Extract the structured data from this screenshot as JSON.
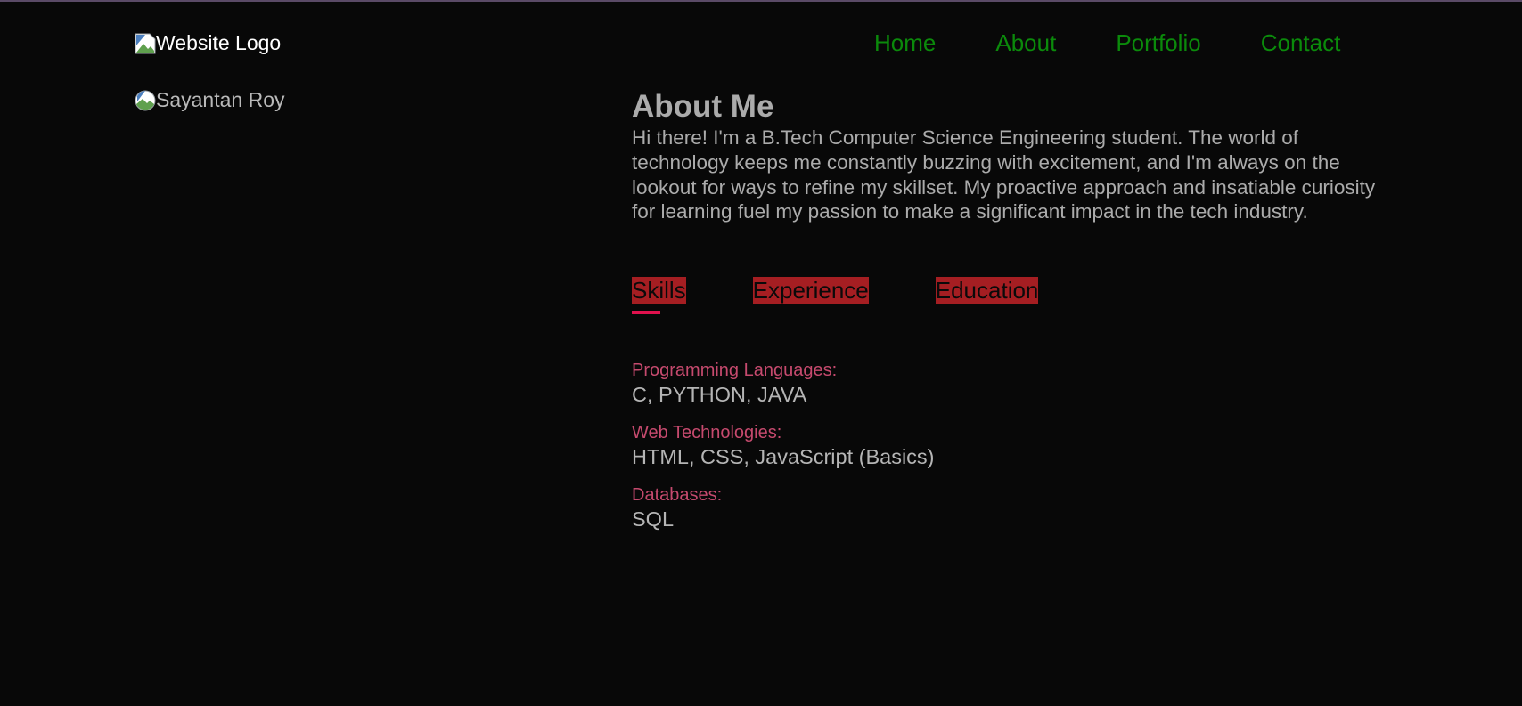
{
  "header": {
    "logo_alt": "Website Logo",
    "nav": [
      {
        "label": "Home"
      },
      {
        "label": "About"
      },
      {
        "label": "Portfolio"
      },
      {
        "label": "Contact"
      }
    ]
  },
  "profile": {
    "image_alt": "Sayantan Roy"
  },
  "about": {
    "title": "About Me",
    "text": "Hi there! I'm a B.Tech Computer Science Engineering student. The world of technology keeps me constantly buzzing with excitement, and I'm always on the lookout for ways to refine my skillset. My proactive approach and insatiable curiosity for learning fuel my passion to make a significant impact in the tech industry."
  },
  "tabs": {
    "items": [
      {
        "label": "Skills",
        "active": true
      },
      {
        "label": "Experience",
        "active": false
      },
      {
        "label": "Education",
        "active": false
      }
    ]
  },
  "skills": [
    {
      "category": "Programming Languages:",
      "value": "C, PYTHON, JAVA"
    },
    {
      "category": "Web Technologies:",
      "value": "HTML, CSS, JavaScript (Basics)"
    },
    {
      "category": "Databases:",
      "value": "SQL"
    }
  ],
  "colors": {
    "background": "#080808",
    "nav_link": "#0b8a0b",
    "tab_bg": "#a51e22",
    "tab_underline": "#e0114d",
    "skill_category": "#c64a6e",
    "body_text": "#ababab"
  }
}
